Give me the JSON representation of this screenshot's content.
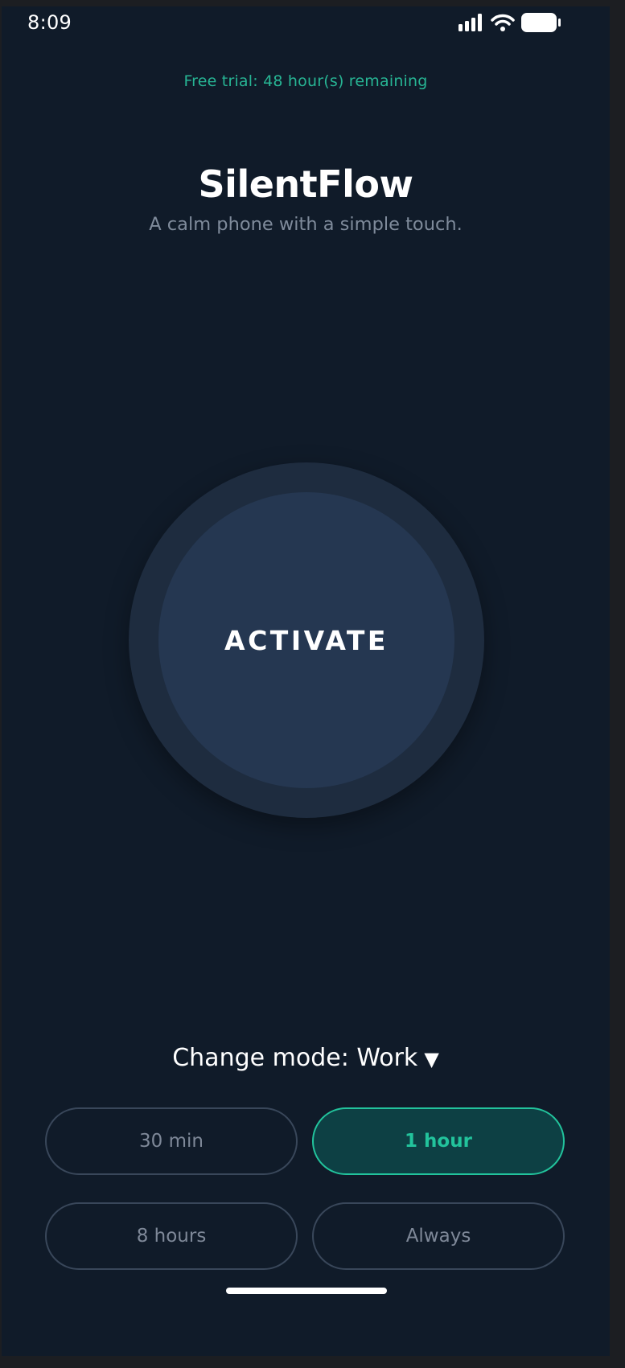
{
  "status_bar": {
    "time": "8:09",
    "icons": [
      "signal-icon",
      "wifi-icon",
      "battery-icon"
    ]
  },
  "trial_banner": "Free trial: 48 hour(s) remaining",
  "app": {
    "title": "SilentFlow",
    "subtitle": "A calm phone with a simple touch."
  },
  "activate_button": {
    "label": "ACTIVATE"
  },
  "mode": {
    "label": "Change mode: Work",
    "arrow": "▼"
  },
  "durations": {
    "options": [
      "30 min",
      "1 hour",
      "8 hours",
      "Always"
    ],
    "selected": "1 hour"
  },
  "colors": {
    "background": "#101b29",
    "accent": "#22c39c",
    "trial_text": "#27b594",
    "button_inner": "#253751",
    "button_ring": "#1e2c3f"
  }
}
